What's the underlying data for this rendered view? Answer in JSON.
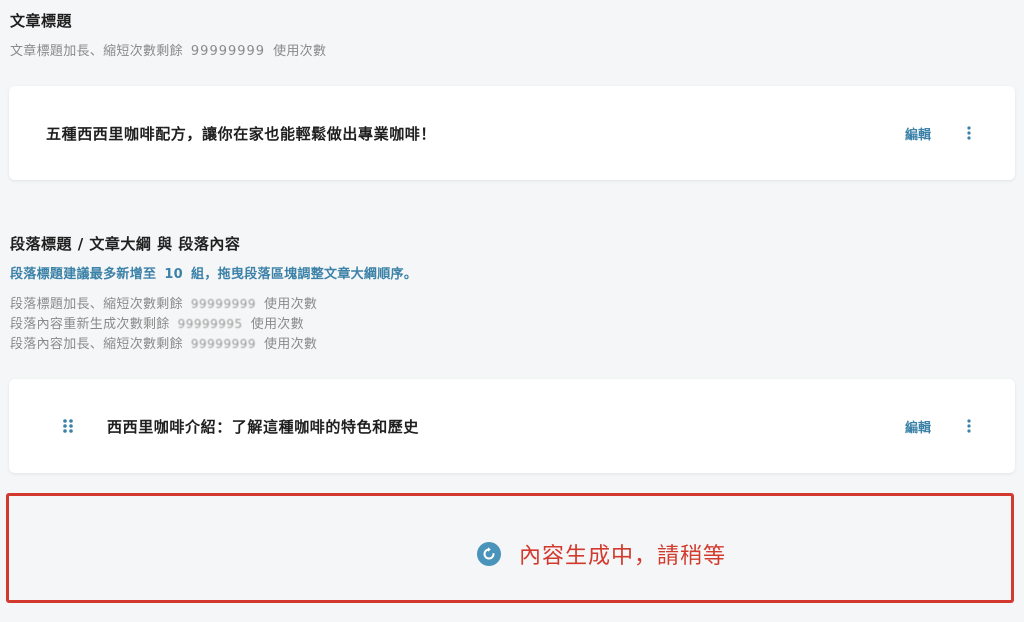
{
  "title_section": {
    "heading": "文章標題",
    "usage_prefix": "文章標題加長、縮短次數剩餘",
    "usage_count": "99999999",
    "usage_suffix": "使用次數",
    "card": {
      "text": "五種西西里咖啡配方，讓你在家也能輕鬆做出專業咖啡！",
      "edit_label": "編輯"
    }
  },
  "outline_section": {
    "heading": "段落標題 / 文章大綱 與 段落內容",
    "hint_prefix": "段落標題建議最多新增至",
    "hint_count": "10",
    "hint_suffix": "組，拖曳段落區塊調整文章大綱順序。",
    "usage_lines": [
      {
        "prefix": "段落標題加長、縮短次數剩餘",
        "count": "99999999",
        "suffix": "使用次數"
      },
      {
        "prefix": "段落內容重新生成次數剩餘",
        "count": "99999995",
        "suffix": "使用次數"
      },
      {
        "prefix": "段落內容加長、縮短次數剩餘",
        "count": "99999999",
        "suffix": "使用次數"
      }
    ],
    "card": {
      "text": "西西里咖啡介紹：了解這種咖啡的特色和歷史",
      "edit_label": "編輯"
    }
  },
  "loading": {
    "text": "內容生成中，請稍等"
  },
  "colors": {
    "accent": "#3c82a8",
    "alert": "#d23a2e",
    "background": "#f5f6f7",
    "muted_text": "#8a8a8a"
  },
  "icons": {
    "more": "more-vertical-icon",
    "drag": "drag-handle-icon",
    "loading": "refresh-icon"
  }
}
